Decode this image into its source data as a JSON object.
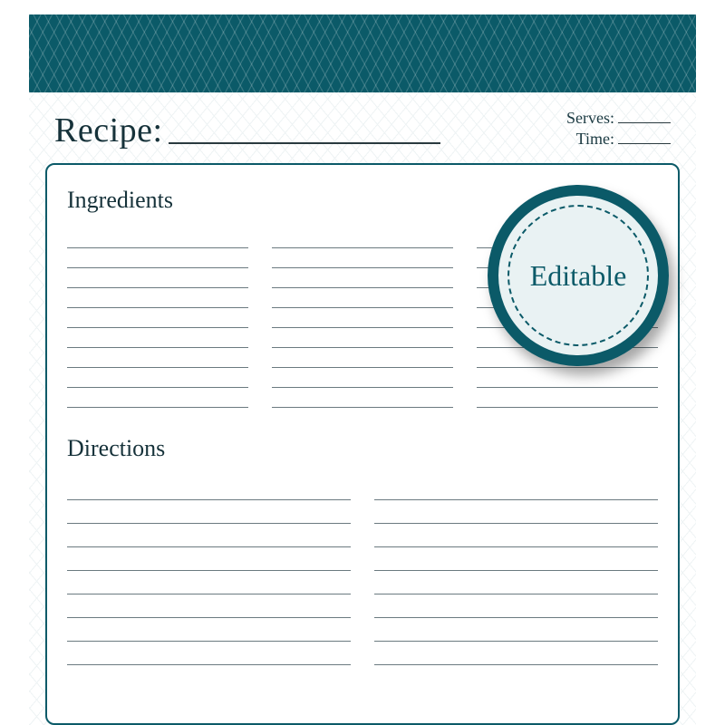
{
  "header": {
    "recipe_label": "Recipe:",
    "serves_label": "Serves:",
    "time_label": "Time:"
  },
  "sections": {
    "ingredients_title": "Ingredients",
    "directions_title": "Directions"
  },
  "badge": {
    "text": "Editable"
  },
  "layout": {
    "ingredient_columns": 3,
    "ingredient_lines_per_column": 9,
    "direction_columns": 2,
    "direction_lines_per_column": 8
  },
  "colors": {
    "accent": "#0b5a68",
    "text": "#16323a",
    "rule": "#6b7a80",
    "badge_fill": "#e9f2f3"
  }
}
